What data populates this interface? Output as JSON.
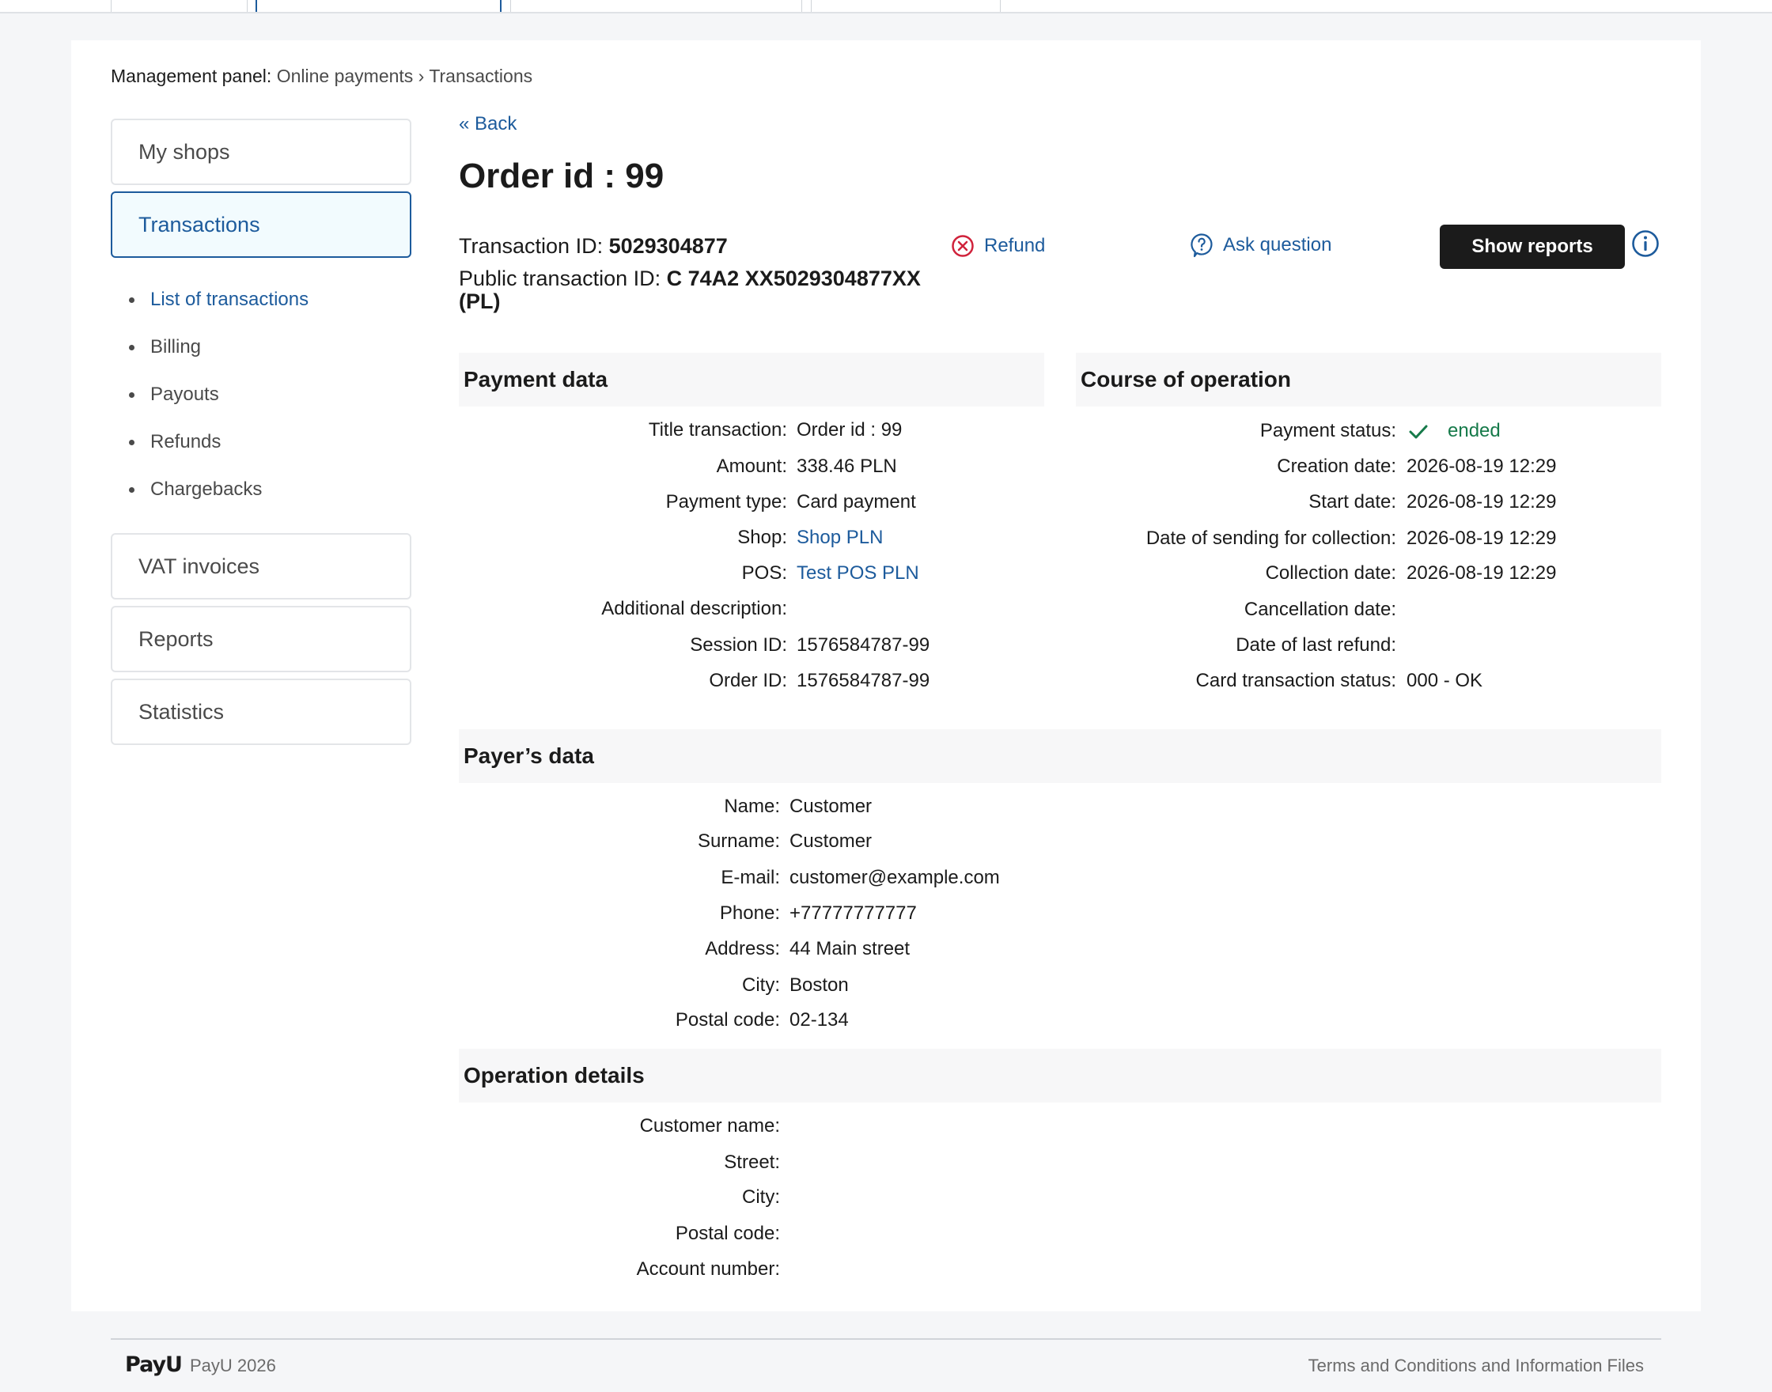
{
  "breadcrumb": {
    "label": "Management panel:",
    "path": "Online payments › Transactions"
  },
  "sidebar": {
    "boxes_top": [
      {
        "label": "My shops"
      },
      {
        "label": "Transactions"
      }
    ],
    "sub_items": [
      {
        "label": "List of transactions"
      },
      {
        "label": "Billing"
      },
      {
        "label": "Payouts"
      },
      {
        "label": "Refunds"
      },
      {
        "label": "Chargebacks"
      }
    ],
    "boxes_bottom": [
      {
        "label": "VAT invoices"
      },
      {
        "label": "Reports"
      },
      {
        "label": "Statistics"
      }
    ]
  },
  "main": {
    "back_label": "« Back",
    "title": "Order id : 99",
    "transaction_id_label": "Transaction ID:",
    "transaction_id": "5029304877",
    "public_id_label": "Public transaction ID:",
    "public_id": "C 74A2 XX5029304877XX (PL)",
    "refund_label": "Refund",
    "ask_label": "Ask question",
    "show_reports_label": "Show reports"
  },
  "payment_data": {
    "heading": "Payment data",
    "rows": [
      {
        "key": "Title transaction:",
        "value": "Order id : 99"
      },
      {
        "key": "Amount:",
        "value": "338.46 PLN"
      },
      {
        "key": "Payment type:",
        "value": "Card payment"
      },
      {
        "key": "Shop:",
        "value": "Shop PLN"
      },
      {
        "key": "POS:",
        "value": "Test POS PLN"
      },
      {
        "key": "Additional description:",
        "value": ""
      },
      {
        "key": "Session ID:",
        "value": "1576584787-99"
      },
      {
        "key": "Order ID:",
        "value": "1576584787-99"
      }
    ]
  },
  "course": {
    "heading": "Course of operation",
    "rows": [
      {
        "key": "Payment status:",
        "value": "ended"
      },
      {
        "key": "Creation date:",
        "value": "2026-08-19 12:29"
      },
      {
        "key": "Start date:",
        "value": "2026-08-19 12:29"
      },
      {
        "key": "Date of sending for collection:",
        "value": "2026-08-19 12:29"
      },
      {
        "key": "Collection date:",
        "value": "2026-08-19 12:29"
      },
      {
        "key": "Cancellation date:",
        "value": ""
      },
      {
        "key": "Date of last refund:",
        "value": ""
      },
      {
        "key": "Card transaction status:",
        "value": "000 - OK"
      }
    ]
  },
  "payer": {
    "heading": "Payer’s data",
    "rows": [
      {
        "key": "Name:",
        "value": "Customer"
      },
      {
        "key": "Surname:",
        "value": "Customer"
      },
      {
        "key": "E-mail:",
        "value": "customer@example.com"
      },
      {
        "key": "Phone:",
        "value": "+77777777777"
      },
      {
        "key": "Address:",
        "value": "44 Main street"
      },
      {
        "key": "City:",
        "value": "Boston"
      },
      {
        "key": "Postal code:",
        "value": "02-134"
      }
    ]
  },
  "operation": {
    "heading": "Operation details",
    "rows": [
      {
        "key": "Customer name:",
        "value": ""
      },
      {
        "key": "Street:",
        "value": ""
      },
      {
        "key": "City:",
        "value": ""
      },
      {
        "key": "Postal code:",
        "value": ""
      },
      {
        "key": "Account number:",
        "value": ""
      }
    ]
  },
  "footer": {
    "logo_text": "PayU",
    "copyright": "PayU 2026",
    "terms": "Terms and Conditions and Information Files"
  },
  "colors": {
    "accent": "#1d5b9c",
    "status_green": "#167a4a",
    "refund_red": "#d0223b",
    "button_dark": "#1b1b1b"
  }
}
